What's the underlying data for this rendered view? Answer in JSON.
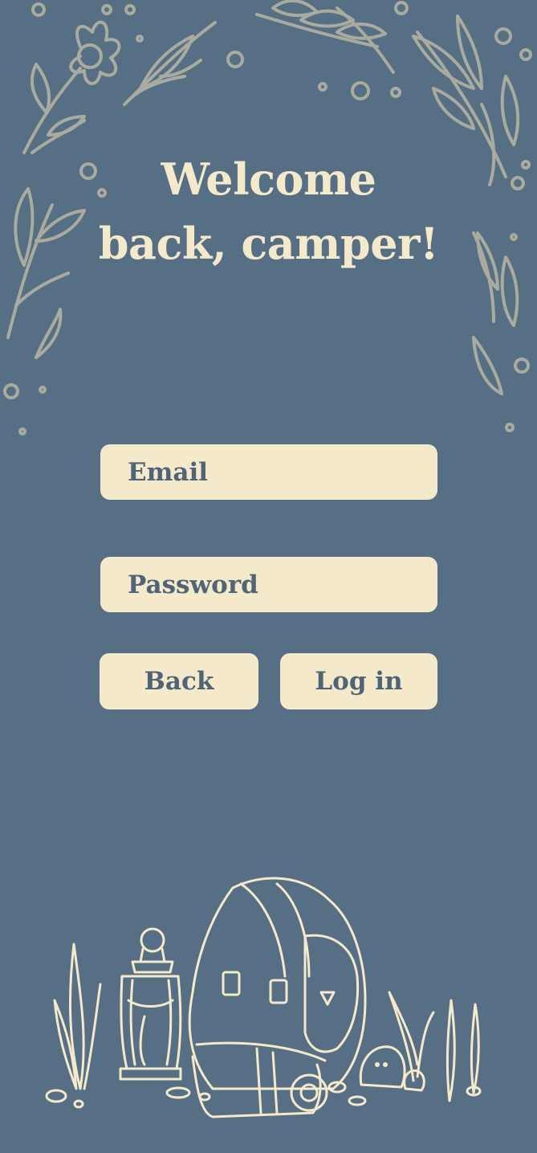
{
  "theme": {
    "background": "#566f84",
    "cream": "#f5e9cb",
    "text_dark": "#4f6476",
    "leaf": "#a9ab9f"
  },
  "welcome": {
    "line1": "Welcome",
    "line2": "back, camper!"
  },
  "form": {
    "email_placeholder": "Email",
    "password_placeholder": "Password"
  },
  "buttons": {
    "back": "Back",
    "login": "Log in"
  },
  "illustrations": {
    "top": "floral-leaves-frame",
    "bottom": "camping-backpack-lantern-scene"
  }
}
